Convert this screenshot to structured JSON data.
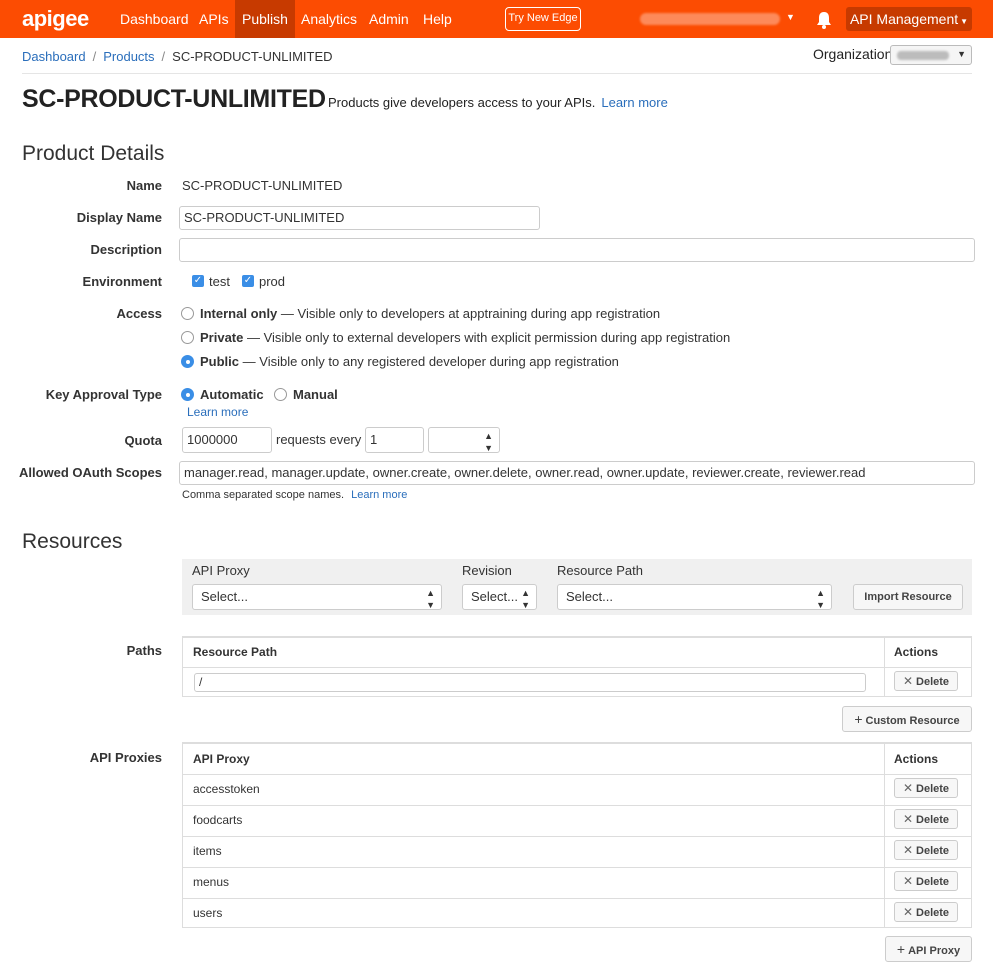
{
  "nav": {
    "logo": "apigee",
    "items": [
      "Dashboard",
      "APIs",
      "Publish",
      "Analytics",
      "Admin",
      "Help"
    ],
    "active": "Publish",
    "try_button": "Try New Edge",
    "api_management": "API Management",
    "accent_color": "#fc4c02",
    "active_color": "#c73a00"
  },
  "breadcrumb": [
    "Dashboard",
    "Products",
    "SC-PRODUCT-UNLIMITED"
  ],
  "organization_label": "Organization",
  "header": {
    "title": "SC-PRODUCT-UNLIMITED",
    "subtitle": "Products give developers access to your APIs.",
    "learn_more": "Learn more"
  },
  "details": {
    "section_title": "Product Details",
    "name_label": "Name",
    "name_value": "SC-PRODUCT-UNLIMITED",
    "display_name_label": "Display Name",
    "display_name_value": "SC-PRODUCT-UNLIMITED",
    "description_label": "Description",
    "description_value": "",
    "environment_label": "Environment",
    "environments": [
      {
        "name": "test",
        "checked": true
      },
      {
        "name": "prod",
        "checked": true
      }
    ],
    "access_label": "Access",
    "access_options": [
      {
        "name": "Internal only",
        "desc": "— Visible only to developers at apptraining during app registration",
        "selected": false
      },
      {
        "name": "Private",
        "desc": "— Visible only to external developers with explicit permission during app registration",
        "selected": false
      },
      {
        "name": "Public",
        "desc": "— Visible only to any registered developer during app registration",
        "selected": true
      }
    ],
    "key_approval_label": "Key Approval Type",
    "key_approval_options": [
      {
        "name": "Automatic",
        "selected": true
      },
      {
        "name": "Manual",
        "selected": false
      }
    ],
    "key_approval_learn_more": "Learn more",
    "quota_label": "Quota",
    "quota_value": "1000000",
    "quota_requests_every": "requests every",
    "quota_interval": "1",
    "quota_unit": "",
    "oauth_label": "Allowed OAuth Scopes",
    "oauth_value": "manager.read, manager.update, owner.create, owner.delete, owner.read, owner.update, reviewer.create, reviewer.read",
    "oauth_help": "Comma separated scope names.",
    "oauth_learn_more": "Learn more"
  },
  "resources": {
    "section_title": "Resources",
    "api_proxy_label": "API Proxy",
    "api_proxy_placeholder": "Select...",
    "revision_label": "Revision",
    "revision_placeholder": "Select...",
    "resource_path_label": "Resource Path",
    "resource_path_placeholder": "Select...",
    "import_button": "Import Resource",
    "paths_label": "Paths",
    "paths_table": {
      "col_path": "Resource Path",
      "col_actions": "Actions",
      "rows": [
        {
          "path": "/",
          "action": "Delete"
        }
      ]
    },
    "custom_resource_button": "Custom Resource",
    "proxies_label": "API Proxies",
    "proxies_table": {
      "col_proxy": "API Proxy",
      "col_actions": "Actions",
      "rows": [
        {
          "proxy": "accesstoken",
          "action": "Delete"
        },
        {
          "proxy": "foodcarts",
          "action": "Delete"
        },
        {
          "proxy": "items",
          "action": "Delete"
        },
        {
          "proxy": "menus",
          "action": "Delete"
        },
        {
          "proxy": "users",
          "action": "Delete"
        }
      ]
    },
    "add_proxy_button": "API Proxy"
  }
}
